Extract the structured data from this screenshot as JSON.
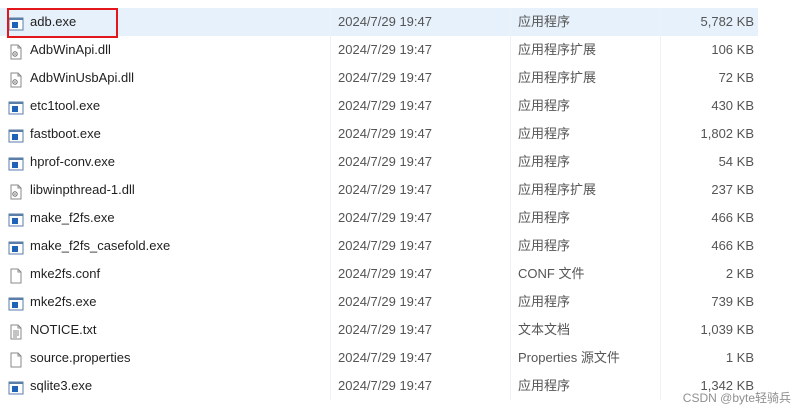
{
  "files": [
    {
      "name": "adb.exe",
      "date": "2024/7/29 19:47",
      "type": "应用程序",
      "size": "5,782 KB",
      "icon": "exe-icon"
    },
    {
      "name": "AdbWinApi.dll",
      "date": "2024/7/29 19:47",
      "type": "应用程序扩展",
      "size": "106 KB",
      "icon": "dll-icon"
    },
    {
      "name": "AdbWinUsbApi.dll",
      "date": "2024/7/29 19:47",
      "type": "应用程序扩展",
      "size": "72 KB",
      "icon": "dll-icon"
    },
    {
      "name": "etc1tool.exe",
      "date": "2024/7/29 19:47",
      "type": "应用程序",
      "size": "430 KB",
      "icon": "exe-icon"
    },
    {
      "name": "fastboot.exe",
      "date": "2024/7/29 19:47",
      "type": "应用程序",
      "size": "1,802 KB",
      "icon": "exe-icon"
    },
    {
      "name": "hprof-conv.exe",
      "date": "2024/7/29 19:47",
      "type": "应用程序",
      "size": "54 KB",
      "icon": "exe-icon"
    },
    {
      "name": "libwinpthread-1.dll",
      "date": "2024/7/29 19:47",
      "type": "应用程序扩展",
      "size": "237 KB",
      "icon": "dll-icon"
    },
    {
      "name": "make_f2fs.exe",
      "date": "2024/7/29 19:47",
      "type": "应用程序",
      "size": "466 KB",
      "icon": "exe-icon"
    },
    {
      "name": "make_f2fs_casefold.exe",
      "date": "2024/7/29 19:47",
      "type": "应用程序",
      "size": "466 KB",
      "icon": "exe-icon"
    },
    {
      "name": "mke2fs.conf",
      "date": "2024/7/29 19:47",
      "type": "CONF 文件",
      "size": "2 KB",
      "icon": "blank-file-icon"
    },
    {
      "name": "mke2fs.exe",
      "date": "2024/7/29 19:47",
      "type": "应用程序",
      "size": "739 KB",
      "icon": "exe-icon"
    },
    {
      "name": "NOTICE.txt",
      "date": "2024/7/29 19:47",
      "type": "文本文档",
      "size": "1,039 KB",
      "icon": "text-file-icon"
    },
    {
      "name": "source.properties",
      "date": "2024/7/29 19:47",
      "type": "Properties 源文件",
      "size": "1 KB",
      "icon": "blank-file-icon"
    },
    {
      "name": "sqlite3.exe",
      "date": "2024/7/29 19:47",
      "type": "应用程序",
      "size": "1,342 KB",
      "icon": "exe-icon"
    }
  ],
  "watermark": "CSDN @byte轻骑兵",
  "colors": {
    "highlight_border": "#e3161b",
    "selected_row": "#e7f1fb",
    "exe_icon_blue": "#1e63b8"
  }
}
